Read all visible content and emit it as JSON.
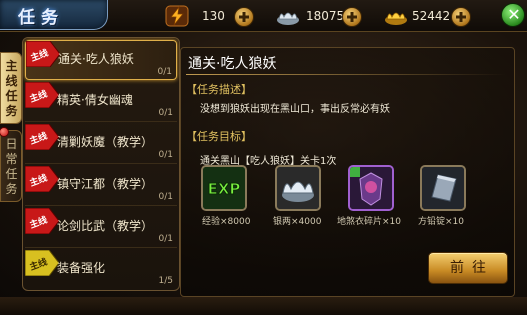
{
  "window": {
    "title": "任务"
  },
  "resources": [
    {
      "icon": "lightning-icon",
      "value": "130"
    },
    {
      "icon": "silver-ingot-icon",
      "value": "18075"
    },
    {
      "icon": "gold-ingot-icon",
      "value": "52442"
    }
  ],
  "side_tabs": [
    {
      "label": "主线任务",
      "active": true
    },
    {
      "label": "日常任务",
      "active": false
    }
  ],
  "quests": [
    {
      "badge": "主线",
      "name": "通关·吃人狼妖",
      "progress": "0/1"
    },
    {
      "badge": "主线",
      "name": "精英·倩女幽魂",
      "progress": "0/1"
    },
    {
      "badge": "主线",
      "name": "清剿妖魔（教学）",
      "progress": "0/1"
    },
    {
      "badge": "主线",
      "name": "镇守江都（教学）",
      "progress": "0/1"
    },
    {
      "badge": "主线",
      "name": "论剑比武（教学）",
      "progress": "0/1"
    },
    {
      "badge": "主线",
      "name": "装备强化",
      "progress": "1/5"
    }
  ],
  "detail": {
    "title": "通关·吃人狼妖",
    "desc_heading": "【任务描述】",
    "desc_text": "没想到狼妖出现在黑山口，事出反常必有妖",
    "goal_heading": "【任务目标】",
    "goal_text": "通关黑山【吃人狼妖】关卡1次",
    "rewards": [
      {
        "icon": "exp-icon",
        "label": "经验×8000",
        "icon_text": "EXP"
      },
      {
        "icon": "silver-ingot-icon",
        "label": "银两×4000"
      },
      {
        "icon": "armor-fragment-icon",
        "label": "地煞衣碎片×10"
      },
      {
        "icon": "whetstone-icon",
        "label": "方铅锭×10"
      }
    ],
    "go_button": "前往"
  }
}
